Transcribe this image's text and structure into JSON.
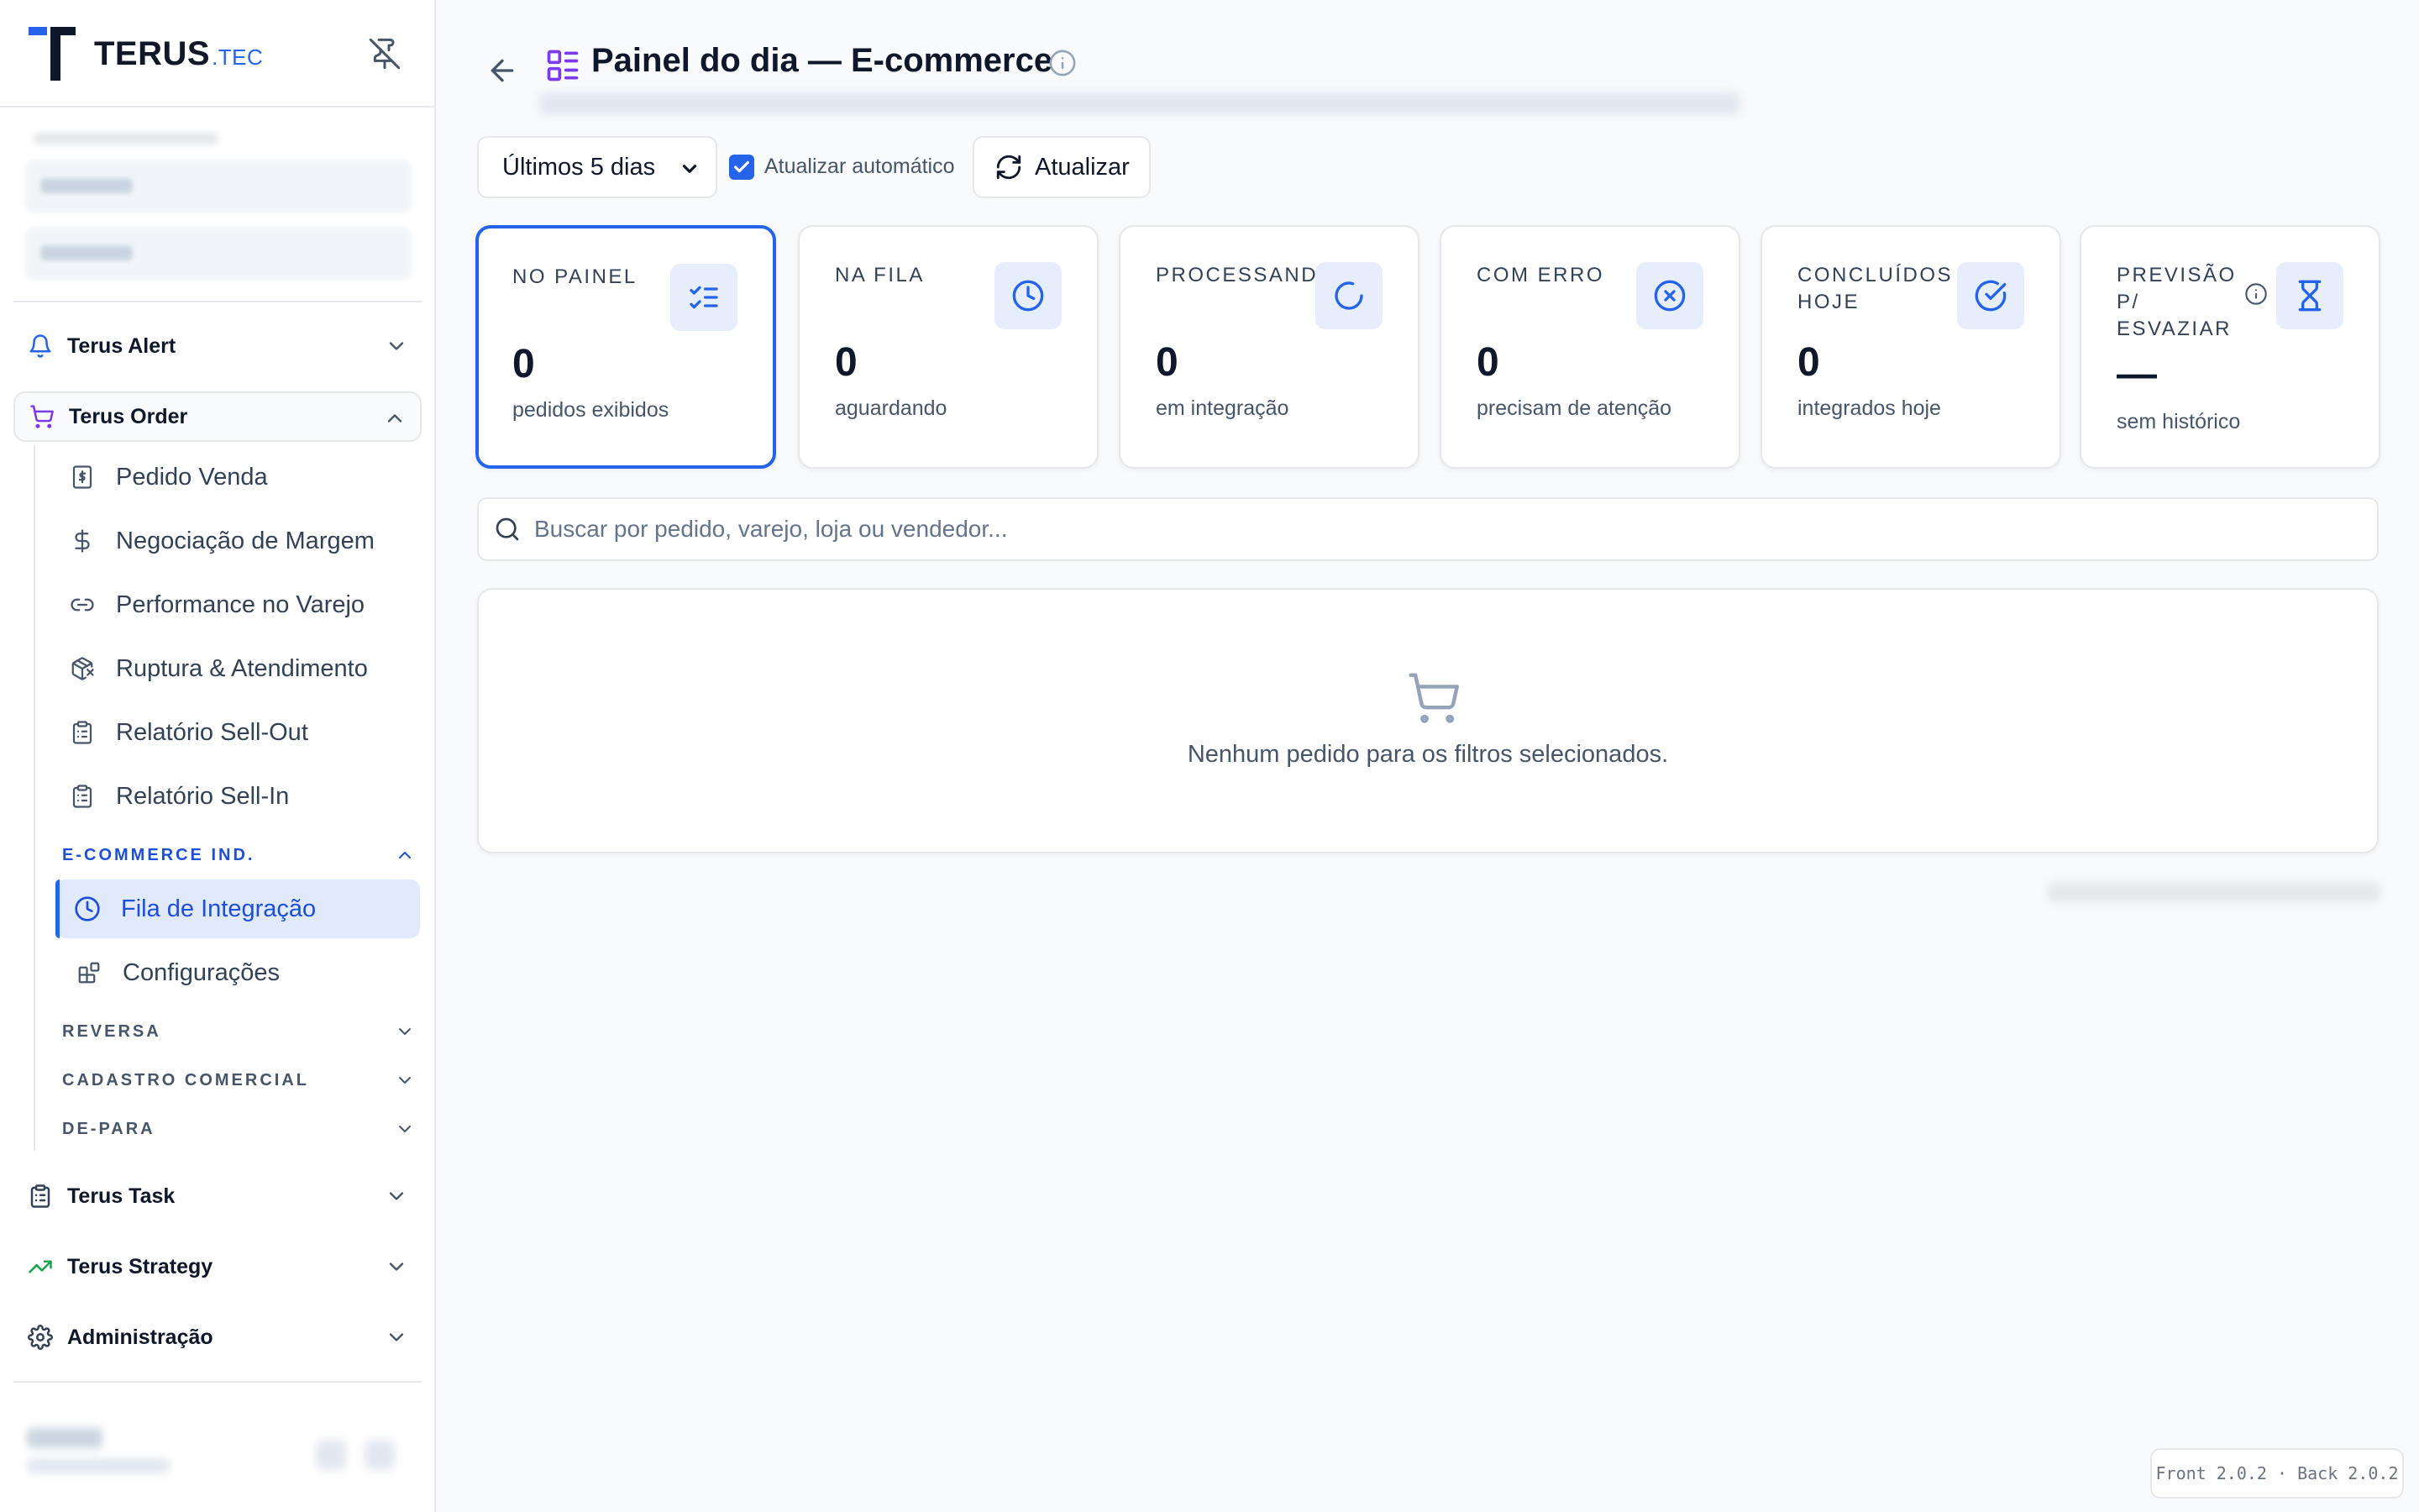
{
  "app": {
    "brand": "TERUS",
    "brand_suffix": ".TEC",
    "accent_color": "#2563eb",
    "purple_color": "#7c3aed",
    "green_color": "#16a34a"
  },
  "sidebar": {
    "groups": {
      "alert": {
        "label": "Terus Alert",
        "icon": "bell-icon",
        "expanded": false
      },
      "order": {
        "label": "Terus Order",
        "icon": "cart-icon",
        "expanded": true
      },
      "task": {
        "label": "Terus Task",
        "icon": "clipboard-icon",
        "expanded": false
      },
      "strategy": {
        "label": "Terus Strategy",
        "icon": "trending-up-icon",
        "expanded": false
      },
      "admin": {
        "label": "Administração",
        "icon": "gear-icon",
        "expanded": false
      }
    },
    "order_items": [
      {
        "label": "Pedido Venda",
        "icon": "dollar-receipt-icon"
      },
      {
        "label": "Negociação de Margem",
        "icon": "dollar-icon"
      },
      {
        "label": "Performance no Varejo",
        "icon": "link-icon"
      },
      {
        "label": "Ruptura & Atendimento",
        "icon": "package-x-icon"
      },
      {
        "label": "Relatório Sell-Out",
        "icon": "clipboard-list-icon"
      },
      {
        "label": "Relatório Sell-In",
        "icon": "clipboard-list-icon"
      }
    ],
    "sections": {
      "ecommerce": {
        "label": "E-COMMERCE IND.",
        "expanded": true
      },
      "reversa": {
        "label": "REVERSA",
        "expanded": false
      },
      "cadastro": {
        "label": "CADASTRO COMERCIAL",
        "expanded": false
      },
      "depara": {
        "label": "DE-PARA",
        "expanded": false
      }
    },
    "ecommerce_items": [
      {
        "label": "Fila de Integração",
        "icon": "clock-icon",
        "active": true
      },
      {
        "label": "Configurações",
        "icon": "blocks-icon",
        "active": false
      }
    ]
  },
  "header": {
    "title": "Painel do dia — E-commerce"
  },
  "toolbar": {
    "period_selected": "Últimos 5 dias",
    "auto_refresh_label": "Atualizar automático",
    "auto_refresh_checked": true,
    "refresh_label": "Atualizar"
  },
  "cards": [
    {
      "label": "NO PAINEL",
      "value": "0",
      "sub": "pedidos exibidos",
      "icon": "list-checks-icon",
      "selected": true
    },
    {
      "label": "NA FILA",
      "value": "0",
      "sub": "aguardando",
      "icon": "clock-icon",
      "selected": false
    },
    {
      "label": "PROCESSANDO",
      "value": "0",
      "sub": "em integração",
      "icon": "loader-icon",
      "selected": false
    },
    {
      "label": "COM ERRO",
      "value": "0",
      "sub": "precisam de atenção",
      "icon": "x-circle-icon",
      "selected": false
    },
    {
      "label": "CONCLUÍDOS HOJE",
      "value": "0",
      "sub": "integrados hoje",
      "icon": "check-circle-icon",
      "selected": false
    },
    {
      "label": "PREVISÃO P/ ESVAZIAR",
      "value": "—",
      "sub": "sem histórico",
      "icon": "hourglass-icon",
      "selected": false
    }
  ],
  "search": {
    "placeholder": "Buscar por pedido, varejo, loja ou vendedor...",
    "value": ""
  },
  "empty_state": {
    "message": "Nenhum pedido para os filtros selecionados."
  },
  "version": {
    "text": "Front 2.0.2 · Back 2.0.2"
  }
}
